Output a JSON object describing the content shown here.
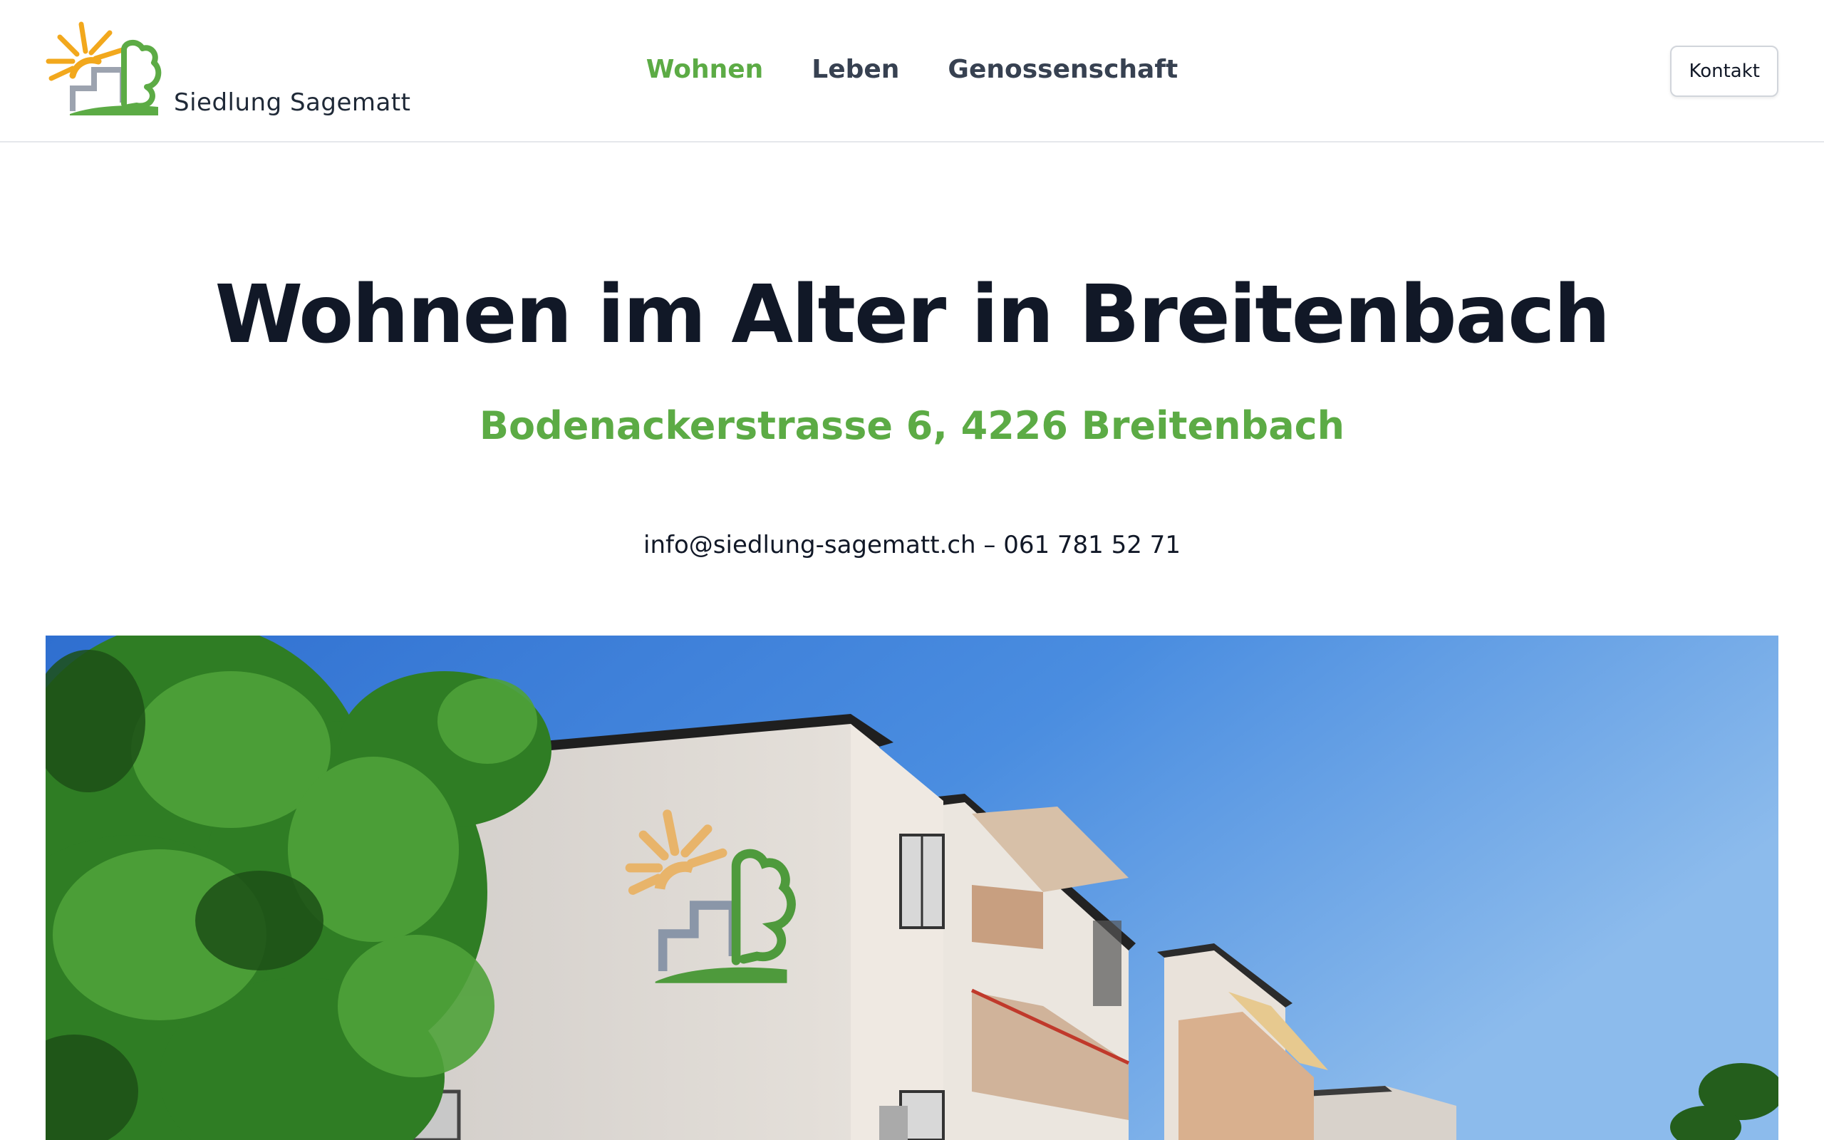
{
  "brand": {
    "name": "Siedlung Sagematt",
    "logo_icon": "sun-house-tree-logo",
    "colors": {
      "sun": "#f2a81d",
      "house": "#9ca3af",
      "tree": "#5cab45"
    }
  },
  "nav": {
    "items": [
      {
        "label": "Wohnen",
        "active": true
      },
      {
        "label": "Leben",
        "active": false
      },
      {
        "label": "Genossenschaft",
        "active": false
      }
    ],
    "contact_label": "Kontakt"
  },
  "hero": {
    "title": "Wohnen im Alter in Breitenbach",
    "subtitle": "Bodenackerstrasse 6, 4226 Breitenbach",
    "email": "info@siedlung-sagematt.ch",
    "separator": "–",
    "phone": "061 781 52 71"
  },
  "image": {
    "icon": "building-photo"
  },
  "colors": {
    "accent": "#5cab45",
    "text": "#111827",
    "nav_text": "#374151",
    "border": "#e5e7eb"
  }
}
